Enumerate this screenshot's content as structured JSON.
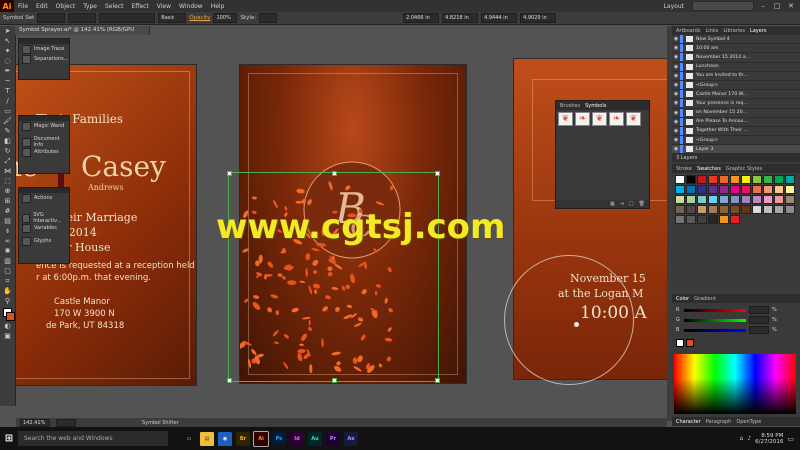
{
  "menubar": {
    "logo": "Ai",
    "items": [
      "File",
      "Edit",
      "Object",
      "Type",
      "Select",
      "Effect",
      "View",
      "Window",
      "Help"
    ],
    "layout_label": "Layout"
  },
  "controlbar": {
    "selection": "Symbol Set",
    "stroke_label": "Basic",
    "opacity_label": "Opacity",
    "opacity_value": "100%",
    "style_label": "Style:",
    "x_value": "2.0466 in",
    "y_value": "4.8218 in",
    "w_value": "4.9444 in",
    "h_value": "4.9029 in"
  },
  "document_tab": "Symbol Sprayer.ai* @ 142.41% (RGB/GPU Preview)",
  "floating_panels": {
    "panel1": [
      "Image Trace",
      "Separations..."
    ],
    "panel2": [
      "Magic Wand",
      "Document Info",
      "Attributes"
    ],
    "panel3": [
      "Actions",
      "SVG Interactiv...",
      "Variables",
      "Glyphs"
    ]
  },
  "artboard_left": {
    "line1": "Their Families",
    "name_big": "Casey",
    "name_small": "Andrews",
    "line_marriage": "ce Their Marriage",
    "line_date": "er 15 2014",
    "line_place": "anor House",
    "invite1": "ence is requested at a reception held",
    "invite2": "r at 6:00p.m. that evening.",
    "address1": "Castle Manor",
    "address2": "170 W 3900 N",
    "address3": "de Park, UT 84318"
  },
  "artboard_right": {
    "date": "November 15",
    "place": "at the Logan M",
    "time": "10:00 A"
  },
  "watermark": "www.cgtsj.com",
  "symbols_panel": {
    "tabs": [
      "Brushes",
      "Symbols"
    ]
  },
  "layers_panel": {
    "tabs": [
      "Artboards",
      "Links",
      "Libraries",
      "Layers"
    ],
    "rows": [
      "New Symbol 4",
      "10:00 am",
      "November 15 2014 a...",
      "Luncheon",
      "You are Invited to th...",
      "<Group>",
      "Castle Manor 170 W...",
      "Your presence is req...",
      "on November 15 20...",
      "Are Please To Annou...",
      "Together With Their ...",
      "<Group>",
      "Layer 3"
    ],
    "count": "3 Layers"
  },
  "swatches_panel": {
    "tabs": [
      "Stroke",
      "Swatches",
      "Graphic Styles"
    ],
    "colors": [
      "#ffffff",
      "#000000",
      "#c8161d",
      "#ee3524",
      "#f26522",
      "#f7941d",
      "#fff200",
      "#8dc63f",
      "#39b54a",
      "#00a651",
      "#00a99d",
      "#00aeef",
      "#0072bc",
      "#2e3192",
      "#662d91",
      "#92278f",
      "#ec008c",
      "#ed145b",
      "#f26c4f",
      "#f69679",
      "#fdc689",
      "#fff799",
      "#c4df9b",
      "#a3d39c",
      "#7accc8",
      "#6dcff6",
      "#7da7d9",
      "#8393ca",
      "#a187be",
      "#bd8cbf",
      "#f49ac1",
      "#f5989d",
      "#998675",
      "#736357",
      "#534741",
      "#c69c6d",
      "#a67c52",
      "#8c6239",
      "#754c24",
      "#603913",
      "#d9d9d9",
      "#bfbfbf",
      "#a6a6a6",
      "#8c8c8c",
      "#737373",
      "#595959",
      "#404040",
      "#262626",
      "#f7941d",
      "#ed1c24"
    ]
  },
  "color_panel": {
    "tabs": [
      "Color",
      "Gradient"
    ],
    "channels": [
      "R",
      "G",
      "B"
    ],
    "unit": "%"
  },
  "bottom_panel": {
    "tabs": [
      "Character",
      "Paragraph",
      "OpenType"
    ]
  },
  "statusbar": {
    "zoom": "142.41%",
    "tool": "Symbol Shifter"
  },
  "taskbar": {
    "search_placeholder": "Search the web and Windows",
    "time": "8:59 PM",
    "date": "6/27/2016"
  }
}
